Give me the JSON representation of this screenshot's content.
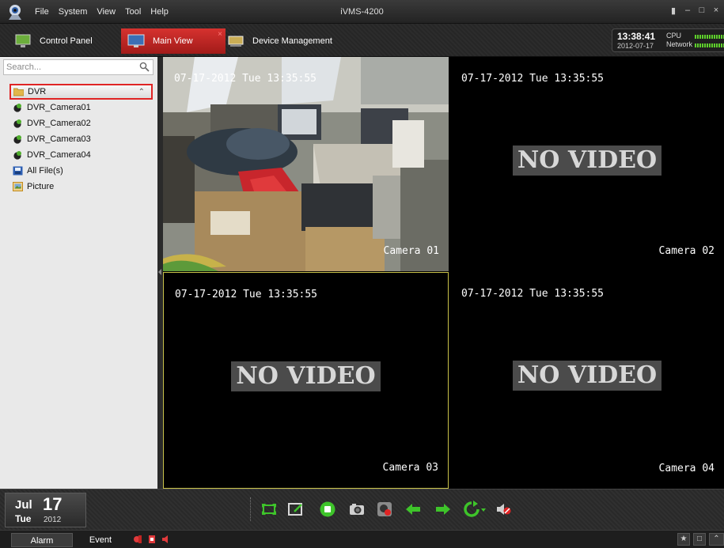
{
  "window": {
    "title": "iVMS-4200",
    "menu": [
      "File",
      "System",
      "View",
      "Tool",
      "Help"
    ]
  },
  "tabs": {
    "control_panel": "Control Panel",
    "main_view": "Main View",
    "device_management": "Device Management"
  },
  "clock": {
    "time": "13:38:41",
    "date": "2012-07-17",
    "cpu_label": "CPU",
    "network_label": "Network"
  },
  "sidebar": {
    "search_placeholder": "Search...",
    "group": "DVR",
    "cameras": [
      "DVR_Camera01",
      "DVR_Camera02",
      "DVR_Camera03",
      "DVR_Camera04"
    ],
    "extras": [
      "All File(s)",
      "Picture"
    ]
  },
  "views": [
    {
      "timestamp": "07-17-2012 Tue 13:35:55",
      "camera": "Camera 01",
      "status": ""
    },
    {
      "timestamp": "07-17-2012 Tue 13:35:55",
      "camera": "Camera 02",
      "status": "NO VIDEO"
    },
    {
      "timestamp": "07-17-2012 Tue 13:35:55",
      "camera": "Camera 03",
      "status": "NO VIDEO"
    },
    {
      "timestamp": "07-17-2012 Tue 13:35:55",
      "camera": "Camera 04",
      "status": "NO VIDEO"
    }
  ],
  "calendar": {
    "month": "Jul",
    "day": "17",
    "weekday": "Tue",
    "year": "2012"
  },
  "statusbar": {
    "alarm": "Alarm",
    "event": "Event"
  },
  "colors": {
    "active_tab": "#c22623",
    "highlight": "#e02424",
    "selected_view_border": "#c9c24a",
    "toolbar_green": "#3ec42a"
  }
}
